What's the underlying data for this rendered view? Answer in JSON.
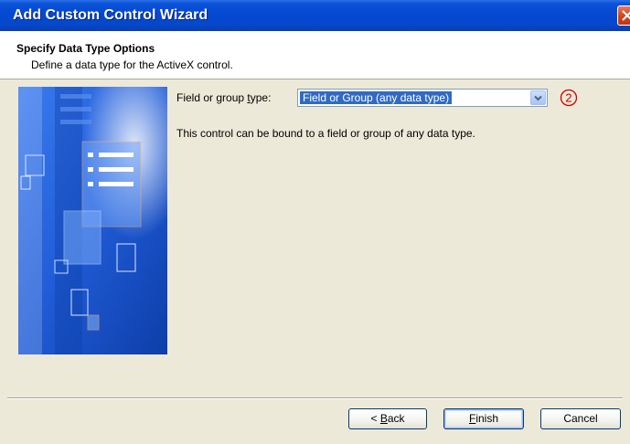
{
  "window": {
    "title": "Add Custom Control Wizard",
    "close_icon": "close-icon",
    "title_gradient": [
      "#2b70e8",
      "#0548cb"
    ],
    "close_color": "#d5461f"
  },
  "header": {
    "title": "Specify Data Type Options",
    "subtitle": "Define a data type for the ActiveX control."
  },
  "content": {
    "field_label_prefix": "Field or group ",
    "field_label_accesskey": "t",
    "field_label_suffix": "ype:",
    "field_value": "Field or Group (any data type)",
    "callout_number": "2",
    "description": "This control can be bound to a field or group of any data type."
  },
  "buttons": {
    "back_prefix": "< ",
    "back_accesskey": "B",
    "back_suffix": "ack",
    "finish_accesskey": "F",
    "finish_suffix": "inish",
    "cancel": "Cancel"
  },
  "colors": {
    "dialog_background": "#ece9d8",
    "selection": "#316ac5",
    "callout": "#cc0000",
    "side_image_blue": "#1f5bd6"
  }
}
